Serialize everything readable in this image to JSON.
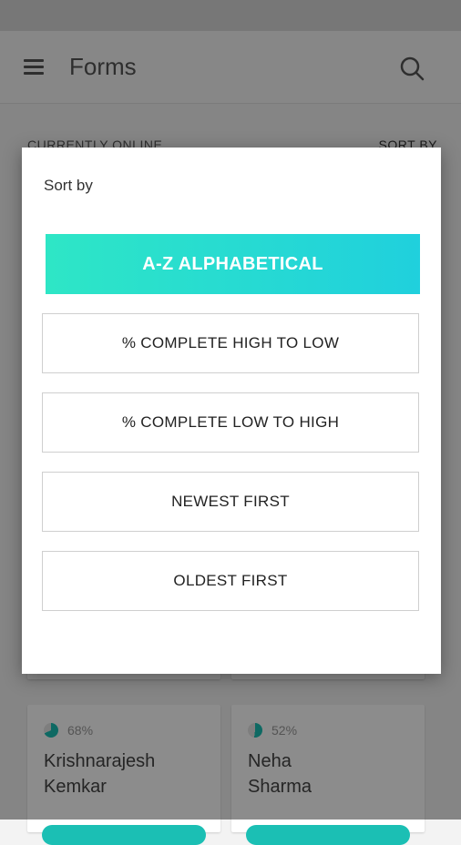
{
  "app_bar": {
    "title": "Forms"
  },
  "section": {
    "left_label": "CURRENTLY ONLINE",
    "right_label": "SORT BY"
  },
  "dialog": {
    "title": "Sort by",
    "options": [
      {
        "label": "A-Z ALPHABETICAL",
        "selected": true
      },
      {
        "label": "% COMPLETE HIGH TO LOW",
        "selected": false
      },
      {
        "label": "% COMPLETE LOW TO HIGH",
        "selected": false
      },
      {
        "label": "NEWEST FIRST",
        "selected": false
      },
      {
        "label": "OLDEST FIRST",
        "selected": false
      }
    ]
  },
  "cards": [
    {
      "percent": "68%",
      "progress": 0.68,
      "first_name": "Krishnarajesh",
      "last_name": "Kemkar"
    },
    {
      "percent": "52%",
      "progress": 0.52,
      "first_name": "Neha",
      "last_name": "Sharma"
    }
  ],
  "colors": {
    "accent": "#22d6c9",
    "progress_fill": "#1bbfb4",
    "progress_track": "#e6e6e6"
  }
}
